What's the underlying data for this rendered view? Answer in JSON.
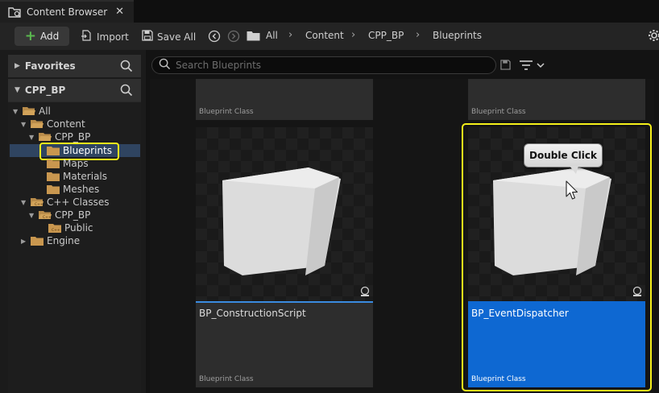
{
  "tab": {
    "title": "Content Browser",
    "close": "✕"
  },
  "toolbar": {
    "add_label": "Add",
    "import_label": "Import",
    "saveall_label": "Save All",
    "breadcrumbs": [
      "All",
      "Content",
      "CPP_BP",
      "Blueprints"
    ]
  },
  "sidebar": {
    "favorites_label": "Favorites",
    "project_label": "CPP_BP",
    "tree": [
      {
        "label": "All",
        "depth": 0
      },
      {
        "label": "Content",
        "depth": 1
      },
      {
        "label": "CPP_BP",
        "depth": 2
      },
      {
        "label": "Blueprints",
        "depth": 3,
        "selected": true
      },
      {
        "label": "Maps",
        "depth": 3
      },
      {
        "label": "Materials",
        "depth": 3
      },
      {
        "label": "Meshes",
        "depth": 3
      },
      {
        "label": "C++ Classes",
        "depth": 1
      },
      {
        "label": "CPP_BP",
        "depth": 2
      },
      {
        "label": "Public",
        "depth": 3
      },
      {
        "label": "Engine",
        "depth": 1
      }
    ]
  },
  "search": {
    "placeholder": "Search Blueprints"
  },
  "assets": [
    {
      "name": "",
      "type": "Blueprint Class"
    },
    {
      "name": "",
      "type": "Blueprint Class"
    },
    {
      "name": "BP_ConstructionScript",
      "type": "Blueprint Class"
    },
    {
      "name": "BP_EventDispatcher",
      "type": "Blueprint Class",
      "selected": true
    }
  ],
  "tooltip": {
    "text": "Double Click"
  },
  "colors": {
    "selection": "#0e68d2",
    "highlight": "#f5f01a",
    "add_plus": "#5ab94f"
  }
}
